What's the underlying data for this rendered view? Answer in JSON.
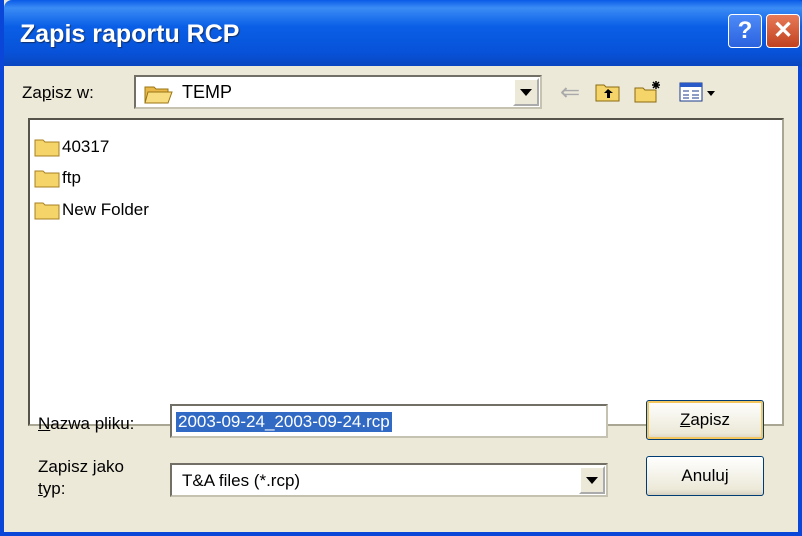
{
  "window": {
    "title": "Zapis raportu RCP"
  },
  "titlebar": {
    "help_label": "?",
    "close_label": "✕"
  },
  "lookin": {
    "label_prefix": "Za",
    "label_accel": "p",
    "label_suffix": "isz w:",
    "value": "TEMP"
  },
  "toolbar": {
    "back_label": "⇐"
  },
  "files": [
    {
      "name": "40317",
      "icon": "folder-icon"
    },
    {
      "name": "ftp",
      "icon": "folder-icon"
    },
    {
      "name": "New Folder",
      "icon": "folder-icon"
    }
  ],
  "filename": {
    "label_accel": "N",
    "label_suffix": "azwa pliku:",
    "value": "2003-09-24_2003-09-24.rcp"
  },
  "filetype": {
    "label_line1": "Zapisz jako",
    "label_accel": "t",
    "label_suffix": "yp:",
    "value": "T&A files (*.rcp)"
  },
  "buttons": {
    "save_accel": "Z",
    "save_suffix": "apisz",
    "cancel_label": "Anuluj"
  },
  "colors": {
    "titlebar": "#0a5fe6",
    "selection": "#316ac5",
    "folder": "#f5d46a"
  }
}
